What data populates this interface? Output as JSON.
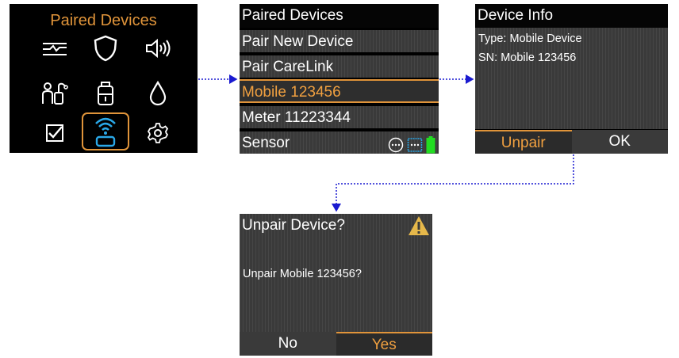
{
  "screen1": {
    "title": "Paired Devices",
    "icons": [
      "sensor-graph-icon",
      "shield-icon",
      "speaker-icon",
      "person-pump-icon",
      "reservoir-icon",
      "drop-icon",
      "checkbox-icon",
      "wireless-device-icon",
      "gear-icon"
    ],
    "selected_icon": "wireless-device-icon",
    "accent": "#e0943a"
  },
  "screen2": {
    "title": "Paired Devices",
    "items": [
      {
        "label": "Pair New Device"
      },
      {
        "label": "Pair CareLink"
      },
      {
        "label": "Mobile 123456"
      },
      {
        "label": "Meter 11223344"
      },
      {
        "label": "Sensor"
      }
    ],
    "selected_index": 2,
    "status_icons": [
      "connection-dots-icon",
      "phone-dots-icon",
      "battery-icon"
    ],
    "battery_color": "#22dd22",
    "selected_color": "#f0a040"
  },
  "screen3": {
    "title": "Device Info",
    "lines": [
      "Type: Mobile Device",
      "SN: Mobile 123456"
    ],
    "buttons": {
      "left": "Unpair",
      "right": "OK"
    }
  },
  "screen4": {
    "title": "Unpair Device?",
    "message": "Unpair Mobile 123456?",
    "buttons": {
      "left": "No",
      "right": "Yes"
    },
    "warning_icon": "warning-icon"
  },
  "connector_color": "#1a1ad0"
}
